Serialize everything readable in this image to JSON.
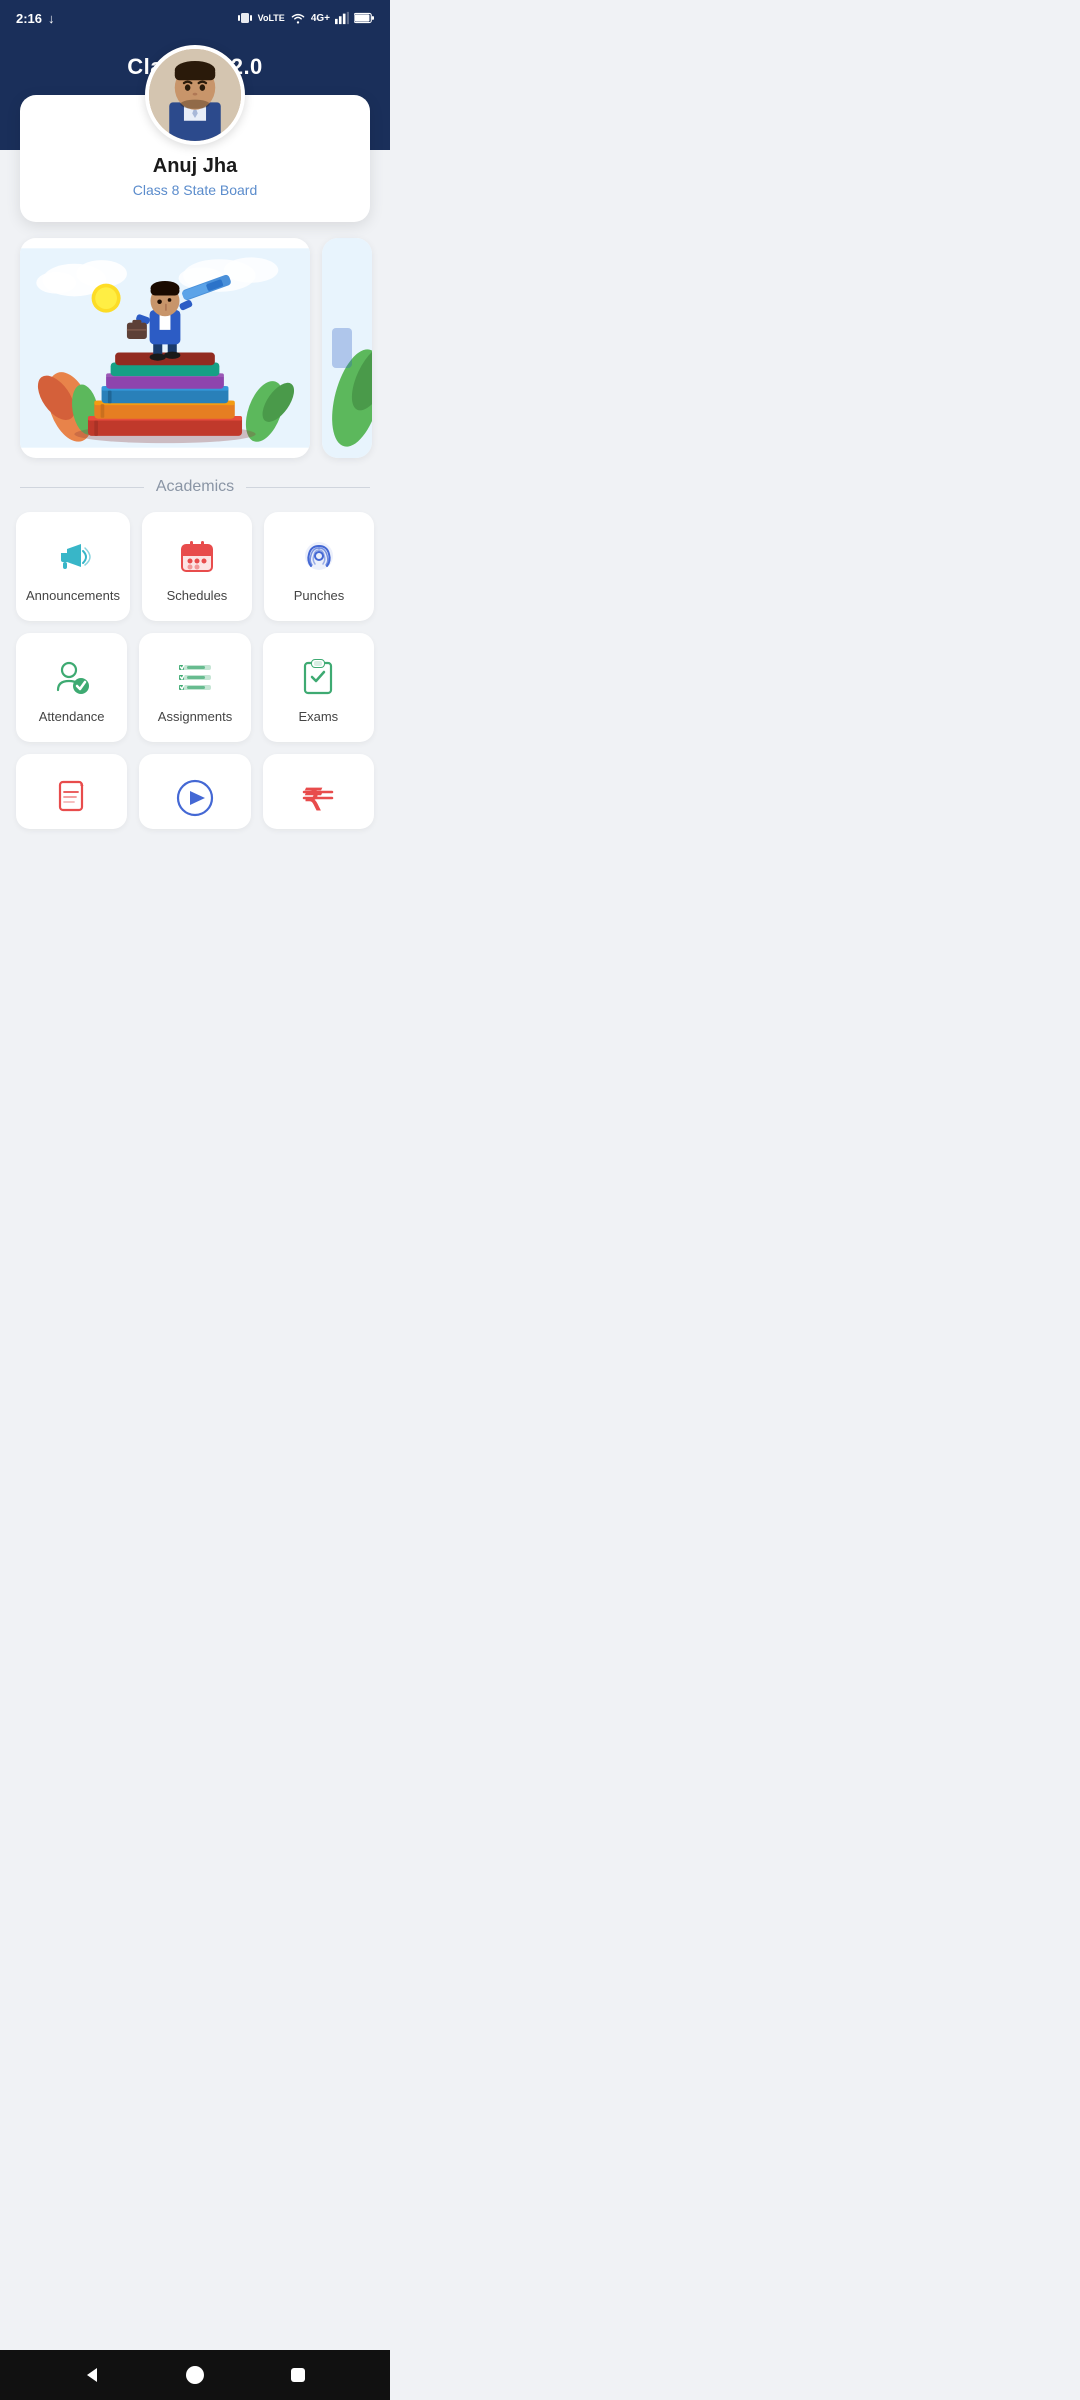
{
  "statusBar": {
    "time": "2:16",
    "downloadIcon": "↓",
    "signals": "vibrate vol 4G+ wifi battery"
  },
  "header": {
    "title": "Classbot 2.0"
  },
  "profile": {
    "name": "Anuj Jha",
    "class": "Class 8 State Board"
  },
  "sections": {
    "academics": "Academics"
  },
  "menuItems": [
    {
      "id": "announcements",
      "label": "Announcements",
      "iconColor": "#38b6c8"
    },
    {
      "id": "schedules",
      "label": "Schedules",
      "iconColor": "#e84c4c"
    },
    {
      "id": "punches",
      "label": "Punches",
      "iconColor": "#4468d4"
    },
    {
      "id": "attendance",
      "label": "Attendance",
      "iconColor": "#3eaa72"
    },
    {
      "id": "assignments",
      "label": "Assignments",
      "iconColor": "#3eaa72"
    },
    {
      "id": "exams",
      "label": "Exams",
      "iconColor": "#3eaa72"
    }
  ],
  "partialItems": [
    {
      "id": "notes",
      "label": "",
      "iconColor": "#e84c4c"
    },
    {
      "id": "videos",
      "label": "",
      "iconColor": "#4468d4"
    },
    {
      "id": "fees",
      "label": "",
      "iconColor": "#e84c4c"
    }
  ],
  "bottomNav": {
    "back": "◀",
    "home": "⏺",
    "recent": "⬛"
  }
}
